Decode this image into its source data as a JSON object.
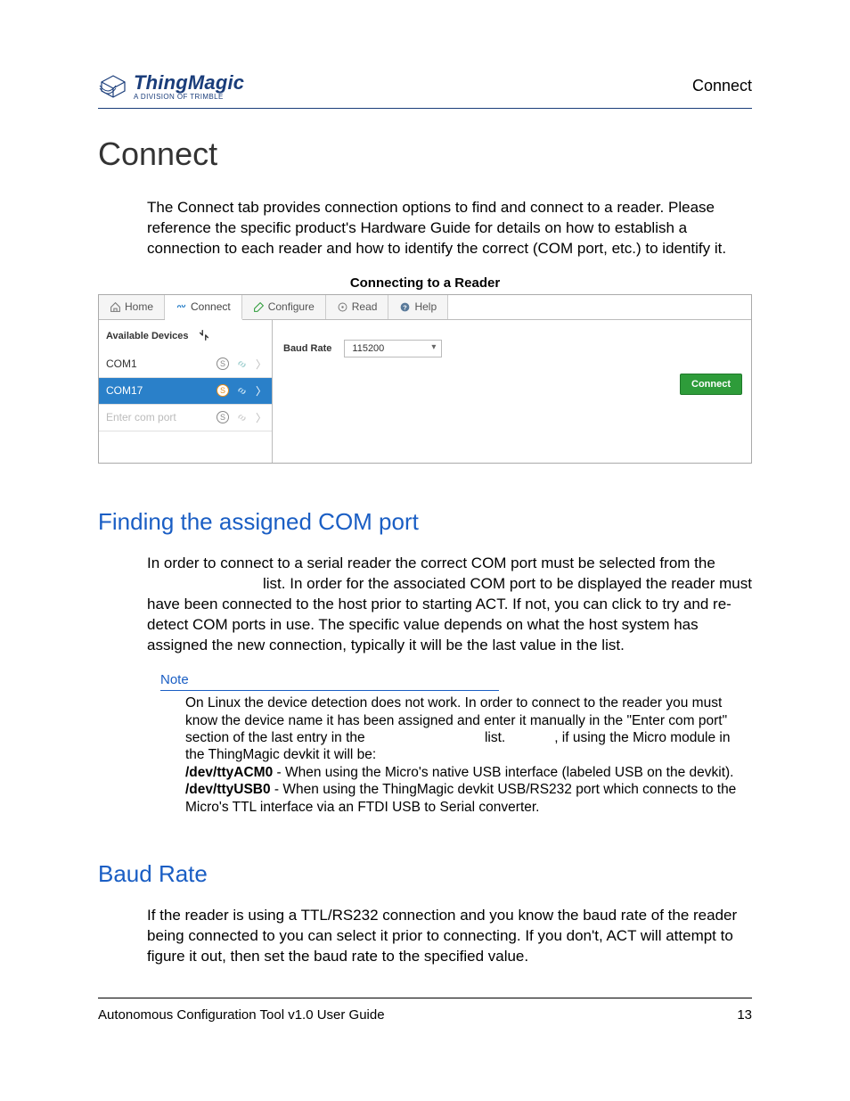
{
  "header": {
    "logo_name": "ThingMagic",
    "logo_sub": "A DIVISION OF TRIMBLE",
    "right": "Connect"
  },
  "title": "Connect",
  "intro": "The Connect tab provides connection options to find and connect to a reader. Please reference the specific product's Hardware Guide for details on how to establish a connection to each reader and how to identify the correct (COM port, etc.) to identify it.",
  "caption": "Connecting to a Reader",
  "app": {
    "tabs": {
      "home": "Home",
      "connect": "Connect",
      "configure": "Configure",
      "read": "Read",
      "help": "Help"
    },
    "available_label": "Available Devices",
    "devices": {
      "d0": "COM1",
      "d1": "COM17",
      "placeholder": "Enter com port"
    },
    "baud_label": "Baud Rate",
    "baud_value": "115200",
    "connect_btn": "Connect"
  },
  "h2a": "Finding the assigned COM port",
  "para2a": "In order to connect to a serial reader the correct COM port must be selected from the",
  "para2b": "list. In order for the associated COM port to be displayed the reader must have been connected to the host prior to starting ACT. If not, you can click",
  "para2c": "to try and re-detect COM ports in use. The specific value depends on what the host system has assigned the new connection, typically it will be the last value in the list.",
  "note": {
    "label": "Note",
    "l1": "On Linux the device detection does not work. In order to connect to the reader you must know the device name it has been assigned and enter it manually in the \"Enter com port\" section of the last entry in the",
    "l1b": "list.",
    "l1c": ", if using the Micro module in the ThingMagic devkit it will be:",
    "dev1": "/dev/ttyACM0",
    "dev1_desc": " - When using the Micro's native USB interface (labeled USB on the devkit).",
    "dev2": "/dev/ttyUSB0",
    "dev2_desc": " - When using the ThingMagic devkit USB/RS232 port which connects to the Micro's TTL interface via an FTDI USB to Serial converter."
  },
  "h2b": "Baud Rate",
  "para3": "If the reader is using a TTL/RS232 connection and you know the baud rate of the reader being connected to you can select it prior to connecting. If you don't, ACT will attempt to figure it out, then set the baud rate to the specified value.",
  "footer": {
    "left": "Autonomous Configuration Tool v1.0 User Guide",
    "right": "13"
  }
}
